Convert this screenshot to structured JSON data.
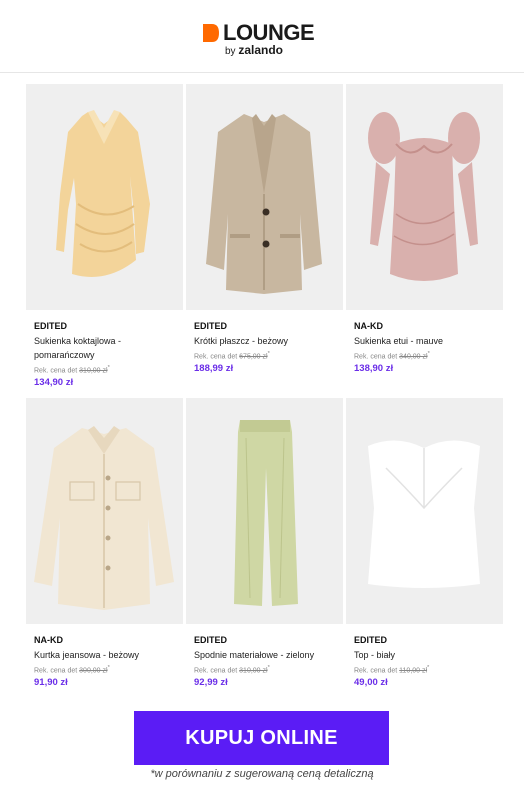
{
  "brand": {
    "logo_word": "LOUNGE",
    "logo_by": "by",
    "logo_partner": "zalando",
    "accent": "#ff6900"
  },
  "colors": {
    "price": "#6b2ee8",
    "cta_bg": "#5b1cf5"
  },
  "products": [
    {
      "brand": "EDITED",
      "name": "Sukienka koktajlowa - pomarańczowy",
      "rrp_label": "Rek. cena det",
      "rrp": "310,00 zł",
      "price": "134,90 zł",
      "image": "orange-wrap-dress"
    },
    {
      "brand": "EDITED",
      "name": "Krótki płaszcz - beżowy",
      "rrp_label": "Rek. cena det",
      "rrp": "675,00 zł",
      "price": "188,99 zł",
      "image": "beige-blazer"
    },
    {
      "brand": "NA-KD",
      "name": "Sukienka etui - mauve",
      "rrp_label": "Rek. cena det",
      "rrp": "340,00 zł",
      "price": "138,90 zł",
      "image": "mauve-puff-dress"
    },
    {
      "brand": "NA-KD",
      "name": "Kurtka jeansowa - beżowy",
      "rrp_label": "Rek. cena det",
      "rrp": "300,00 zł",
      "price": "91,90 zł",
      "image": "cream-denim-jacket"
    },
    {
      "brand": "EDITED",
      "name": "Spodnie materiałowe - zielony",
      "rrp_label": "Rek. cena det",
      "rrp": "310,00 zł",
      "price": "92,99 zł",
      "image": "green-trousers"
    },
    {
      "brand": "EDITED",
      "name": "Top - biały",
      "rrp_label": "Rek. cena det",
      "rrp": "110,00 zł",
      "price": "49,00 zł",
      "image": "white-bandeau-top"
    }
  ],
  "cta": {
    "label": "KUPUJ ONLINE"
  },
  "footnote": "*w porównaniu z sugerowaną ceną detaliczną"
}
